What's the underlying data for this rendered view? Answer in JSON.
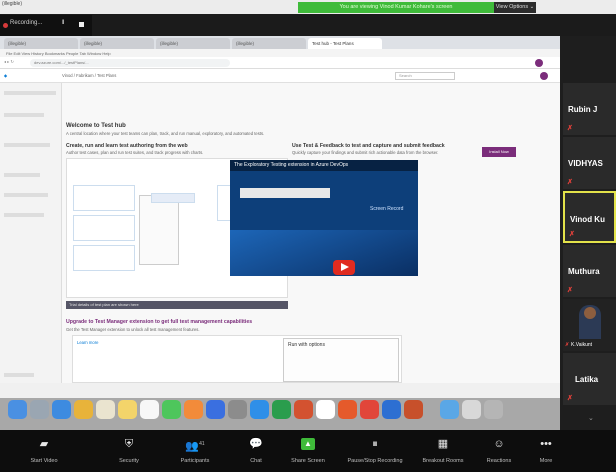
{
  "top": {
    "title": "(illegible)",
    "share_banner": "You are viewing Vinod Kumar Kohare's screen",
    "view_options": "View Options ⌄"
  },
  "recording": {
    "label": "Recording...",
    "pause": "II",
    "stop": "■"
  },
  "browser": {
    "tabs": [
      "(illegible)",
      "(illegible)",
      "(illegible)",
      "(illegible)",
      "Test hub - Test Plans"
    ],
    "menu": "File  Edit  View  History  Bookmarks  People  Tab  Window  Help",
    "url": "dev.azure.com/.../_testPlans/...",
    "header_crumbs": "Vinod / Fabrikam / Test Plans",
    "search_placeholder": "Search"
  },
  "hub": {
    "title": "Welcome to Test hub",
    "intro": "A central location where your test teams can plan, track, and run manual, exploratory, and automated tests.",
    "section1_title": "Create, run and learn test authoring from the web",
    "section1_text": "Author test cases, plan and run test suites, and track progress with charts.",
    "section2_title": "Use Test & Feedback to test and capture and submit feedback",
    "section2_text": "Quickly capture your findings and submit rich actionable data from the browser.",
    "install_button": "Install Now",
    "video_title": "The Exploratory Testing extension in Azure DevOps",
    "video_sub": "Screen Record",
    "banner": "Trial details of test plan are shown here",
    "section3_title": "Upgrade to Test Manager extension to get full test management capabilities",
    "section3_text": "Get the Test Manager extension to unlock all test management features.",
    "upgrade_link": "Learn more",
    "runs_title": "Run with options"
  },
  "participants": [
    {
      "name": "Rubin J",
      "muted": true
    },
    {
      "name": "VIDHYAS",
      "muted": true
    },
    {
      "name": "Vinod Ku",
      "muted": true
    },
    {
      "name": "Muthura",
      "muted": true
    },
    {
      "name": "K.Vaikunt",
      "muted": true
    },
    {
      "name": "Latika",
      "muted": true
    }
  ],
  "bottom_bar": [
    {
      "label": "Start Video",
      "icon": "video-off-icon"
    },
    {
      "label": "Security",
      "icon": "security-icon"
    },
    {
      "label": "Participants",
      "icon": "participants-icon",
      "count": "41"
    },
    {
      "label": "Chat",
      "icon": "chat-icon"
    },
    {
      "label": "Share Screen",
      "icon": "share-screen-icon"
    },
    {
      "label": "Pause/Stop Recording",
      "icon": "recording-icon"
    },
    {
      "label": "Breakout Rooms",
      "icon": "breakout-icon"
    },
    {
      "label": "Reactions",
      "icon": "reactions-icon"
    },
    {
      "label": "More",
      "icon": "more-icon"
    }
  ],
  "colors": {
    "accent_green": "#3fbb3a",
    "mute_red": "#e0403a",
    "azure_purple": "#7b2d7b",
    "active_speaker": "#e3e24a"
  }
}
